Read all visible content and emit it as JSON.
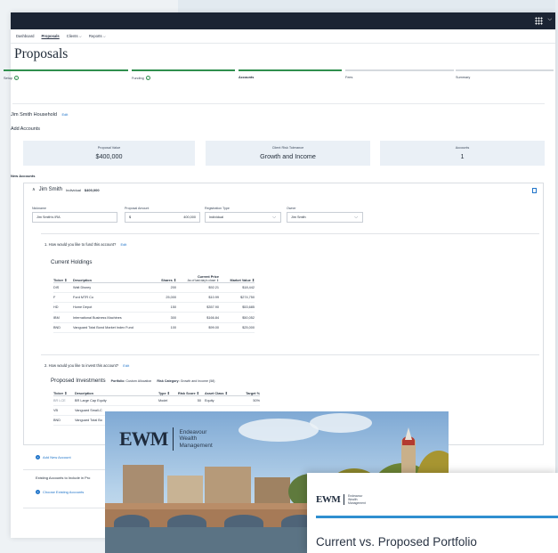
{
  "nav": {
    "items": [
      "Dashboard",
      "Proposals",
      "Clients ⌵",
      "Reports ⌵"
    ]
  },
  "page": {
    "title": "Proposals"
  },
  "steps": [
    {
      "label": "Setup",
      "done": true,
      "check": true
    },
    {
      "label": "Funding",
      "done": true,
      "check": true
    },
    {
      "label": "Accounts",
      "done": true,
      "check": false,
      "current": true
    },
    {
      "label": "Fees",
      "done": false,
      "check": false
    },
    {
      "label": "Summary",
      "done": false,
      "check": false
    }
  ],
  "household": {
    "name": "Jim Smith Household",
    "edit": "Edit"
  },
  "add_accounts": "Add Accounts",
  "stats": [
    {
      "label": "Proposal Value",
      "value": "$400,000"
    },
    {
      "label": "Client Risk Tolerance",
      "value": "Growth and Income"
    },
    {
      "label": "Accounts",
      "value": "1"
    }
  ],
  "new_accounts": "New Accounts",
  "account": {
    "name": "Jim Smith",
    "type": "Individual",
    "amount": "$400,000",
    "fields": {
      "nickname_label": "Nickname",
      "nickname_value": "Jim Smith's IRA",
      "proposal_label": "Proposal Amount",
      "proposal_prefix": "$",
      "proposal_value": "400,000",
      "reg_label": "Registration Type",
      "reg_value": "Individual",
      "owner_label": "Owner",
      "owner_value": "Jim Smith"
    }
  },
  "q1": {
    "text": "1. How would you like to fund this account?",
    "edit": "Edit"
  },
  "holdings": {
    "title": "Current Holdings",
    "headers": [
      "Ticker ⇕",
      "Description",
      "Shares ⇕",
      "Current Price",
      "Market Value ⇕"
    ],
    "price_sub": "As of last day's close ⇕",
    "rows": [
      [
        "DIS",
        "Walt Disney",
        "200",
        "$92.21",
        "$18,442"
      ],
      [
        "F",
        "Ford MTR Co",
        "25,000",
        "$10.99",
        "$274,750"
      ],
      [
        "HD",
        "Home Depot",
        "150",
        "$357.90",
        "$53,685"
      ],
      [
        "IBM",
        "International Business Machines",
        "300",
        "$166.84",
        "$50,052"
      ],
      [
        "BND",
        "Vanguard Total Bond Market Index Fund",
        "100",
        "$99.00",
        "$25,000"
      ]
    ]
  },
  "q2": {
    "text": "2. How would you like to invest this account?",
    "edit": "Edit"
  },
  "proposed": {
    "title": "Proposed Investments",
    "portfolio_label": "Portfolio:",
    "portfolio_value": "Custom Allocation",
    "risk_label": "Risk Category:",
    "risk_value": "Growth and Income (58)",
    "headers": [
      "Ticker ⇕",
      "Description",
      "Type ⇕",
      "Risk Score ⇕",
      "Asset Class ⇕",
      "Target %"
    ],
    "rows": [
      [
        "BR LCE",
        "BR Large Cap Equity",
        "Model",
        "50",
        "Equity",
        "50%"
      ],
      [
        "VB",
        "Vanguard Small-C",
        "",
        "",
        "",
        ""
      ],
      [
        "BND",
        "Vanguard Total Bo",
        "",
        "",
        "",
        ""
      ]
    ]
  },
  "links": {
    "add_new": "Add New Account",
    "existing": "Existing Accounts to Include in Pro",
    "choose": "Choose Existing Accounts"
  },
  "brochure": {
    "mark": "EWM",
    "line1": "Endeavour",
    "line2": "Wealth",
    "line3": "Management"
  },
  "report": {
    "mark": "EWM",
    "line1": "Endeavour",
    "line2": "Wealth",
    "line3": "Management",
    "title": "Current vs. Proposed Portfolio"
  },
  "colors": {
    "accent": "#1f74c9",
    "success": "#2f8f4e",
    "topbar": "#1b2433",
    "rule": "#2f8fd0"
  }
}
